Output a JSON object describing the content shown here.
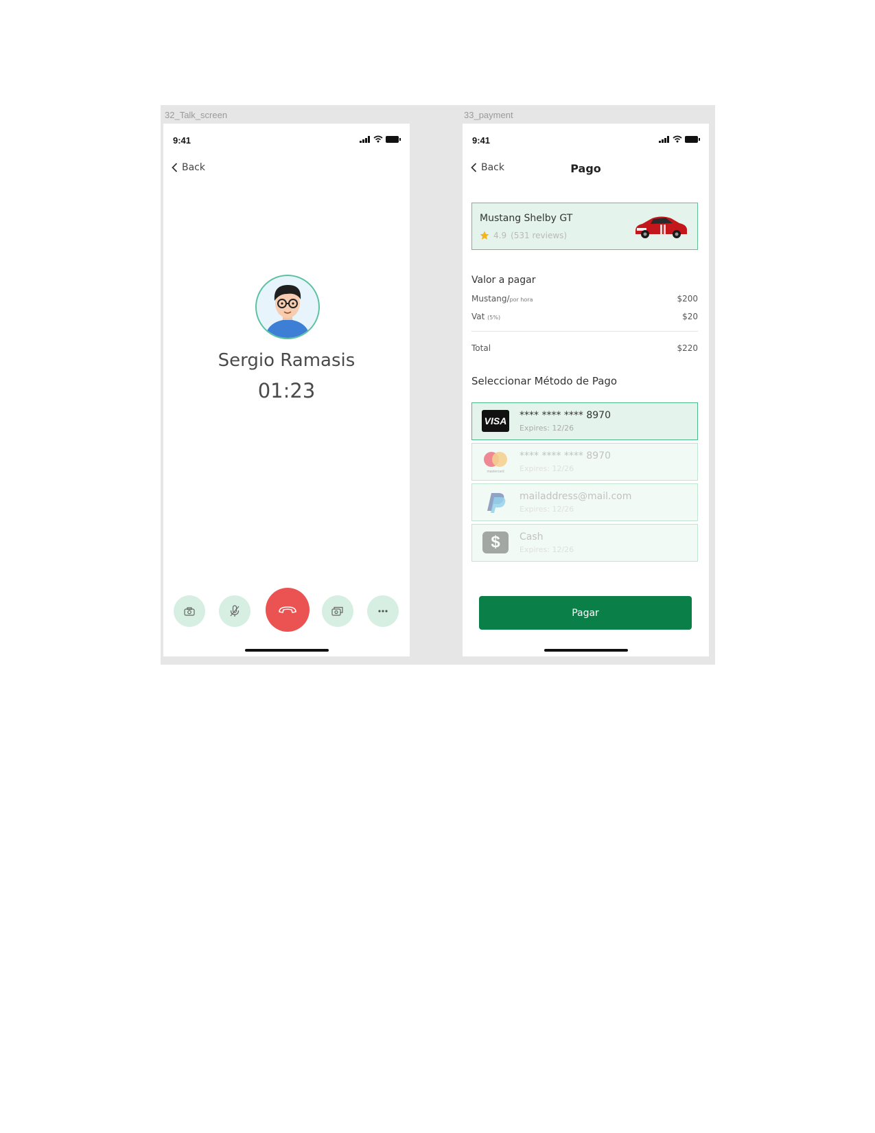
{
  "colors": {
    "accent_green": "#0a7f48",
    "light_green": "#d6efe2",
    "end_call_red": "#eb5252",
    "star": "#f5b41a"
  },
  "talk_screen": {
    "frame_label": "32_Talk_screen",
    "status": {
      "time": "9:41",
      "icons": [
        "signal-icon",
        "wifi-icon",
        "battery-icon"
      ]
    },
    "back_label": "Back",
    "caller_name": "Sergio Ramasis",
    "timer": "01:23",
    "controls": [
      "camera-icon",
      "mute-mic-icon",
      "end-call-icon",
      "switch-camera-icon",
      "more-icon"
    ]
  },
  "payment_screen": {
    "frame_label": "33_payment",
    "status": {
      "time": "9:41"
    },
    "back_label": "Back",
    "title": "Pago",
    "car": {
      "name": "Mustang Shelby GT",
      "rating": "4.9",
      "reviews": "(531 reviews)"
    },
    "summary": {
      "title": "Valor a pagar",
      "line1_label": "Mustang/",
      "line1_unit": "por hora",
      "line1_value": "$200",
      "line2_label": "Vat",
      "line2_unit": "(5%)",
      "line2_value": "$20",
      "total_label": "Total",
      "total_value": "$220"
    },
    "methods_title": "Seleccionar Método de Pago",
    "methods": [
      {
        "logo": "VISA",
        "main": "**** **** **** 8970",
        "sub": "Expires: 12/26",
        "selected": true
      },
      {
        "logo": "mastercard",
        "main": "**** **** **** 8970",
        "sub": "Expires: 12/26",
        "selected": false
      },
      {
        "logo": "paypal-icon",
        "main": "mailaddress@mail.com",
        "sub": "Expires: 12/26",
        "selected": false
      },
      {
        "logo": "cash-icon",
        "main": "Cash",
        "sub": "Expires: 12/26",
        "selected": false
      }
    ],
    "pay_button": "Pagar"
  }
}
